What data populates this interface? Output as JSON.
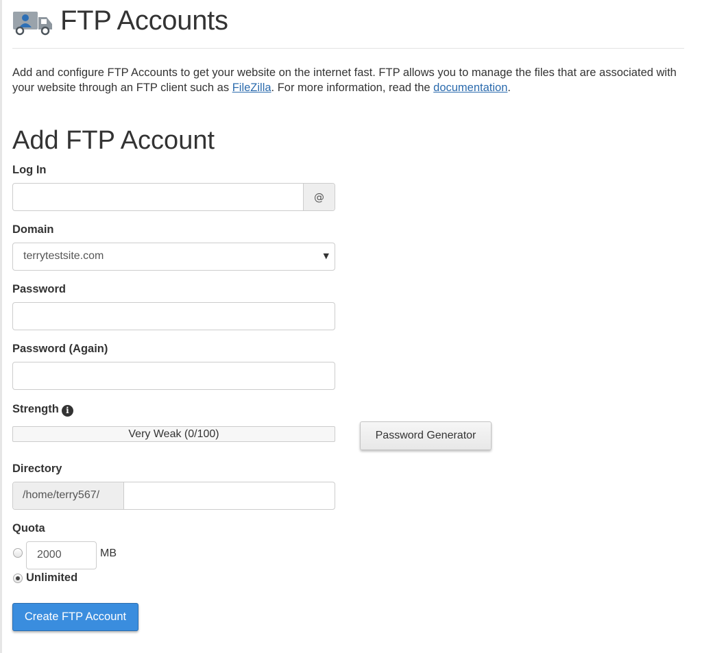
{
  "header": {
    "title": "FTP Accounts",
    "icon": "ftp-truck-user-icon"
  },
  "intro": {
    "text_before": "Add and configure FTP Accounts to get your website on the internet fast. FTP allows you to manage the files that are associated with your website through an FTP client such as ",
    "filezilla_link": "FileZilla",
    "text_middle": ". For more information, read the ",
    "documentation_link": "documentation",
    "text_after": "."
  },
  "form": {
    "section_title": "Add FTP Account",
    "login_label": "Log In",
    "login_value": "",
    "login_addon": "@",
    "domain_label": "Domain",
    "domain_selected": "terrytestsite.com",
    "password_label": "Password",
    "password_again_label": "Password (Again)",
    "strength_label": "Strength",
    "strength_text": "Very Weak (0/100)",
    "password_generator_label": "Password Generator",
    "directory_label": "Directory",
    "directory_prefix": "/home/terry567/",
    "directory_value": "",
    "quota_label": "Quota",
    "quota_value": "2000",
    "quota_unit": "MB",
    "unlimited_label": "Unlimited",
    "unlimited_selected": true,
    "submit_label": "Create FTP Account"
  },
  "colors": {
    "link": "#2a6aad",
    "primary_button": "#3a8dde"
  }
}
